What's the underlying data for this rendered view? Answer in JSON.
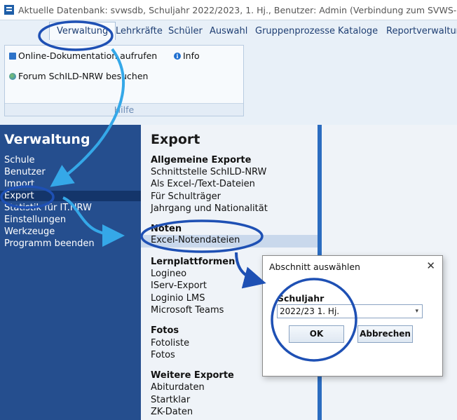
{
  "window": {
    "title": "Aktuelle Datenbank: svwsdb, Schuljahr 2022/2023, 1. Hj., Benutzer: Admin (Verbindung zum SVWS-Server vorha"
  },
  "ribbon": {
    "tabs": [
      "Verwaltung",
      "Lehrkräfte",
      "Schüler",
      "Auswahl",
      "Gruppenprozesse",
      "Kataloge",
      "Reportverwaltung"
    ],
    "buttons": {
      "online_doc": "Online-Dokumentation aufrufen",
      "info": "Info",
      "forum": "Forum SchILD-NRW besuchen"
    },
    "group_label": "Hilfe"
  },
  "leftnav": {
    "title": "Verwaltung",
    "items": [
      "Schule",
      "Benutzer",
      "Import",
      "Export",
      "Statistik für IT.NRW",
      "Einstellungen",
      "Werkzeuge",
      "Programm beenden"
    ]
  },
  "midpanel": {
    "title": "Export",
    "sections": [
      {
        "heading": "Allgemeine Exporte",
        "items": [
          "Schnittstelle SchILD-NRW",
          "Als Excel-/Text-Dateien",
          "Für Schulträger",
          "Jahrgang und Nationalität"
        ]
      },
      {
        "heading": "Noten",
        "items": [
          "Excel-Notendateien"
        ]
      },
      {
        "heading": "Lernplattformen",
        "items": [
          "Logineo",
          "IServ-Export",
          "Loginio LMS",
          "Microsoft Teams"
        ]
      },
      {
        "heading": "Fotos",
        "items": [
          "Fotoliste",
          "Fotos"
        ]
      },
      {
        "heading": "Weitere Exporte",
        "items": [
          "Abiturdaten",
          "Startklar",
          "ZK-Daten"
        ]
      }
    ]
  },
  "dialog": {
    "title": "Abschnitt auswählen",
    "close": "✕",
    "label": "Schuljahr",
    "selected_value": "2022/23 1. Hj.",
    "ok": "OK",
    "cancel": "Abbrechen"
  },
  "colors": {
    "nav_bg": "#254e8e",
    "nav_selected": "#14356a",
    "annotation_blue": "#1e50b4",
    "annotation_cyan": "#35a8e8"
  }
}
